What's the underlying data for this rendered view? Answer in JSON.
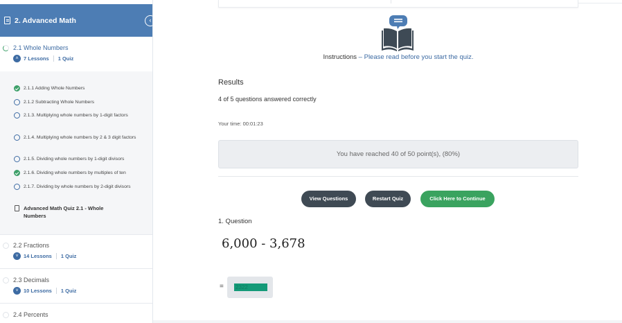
{
  "sidebar": {
    "course_title": "2. Advanced Math",
    "collapse_glyph": "‹",
    "active_section": {
      "title": "2.1 Whole Numbers",
      "lessons": "7 Lessons",
      "quizzes": "1 Quiz",
      "chevron": "˄"
    },
    "lessons": [
      {
        "label": "2.1.1 Adding Whole Numbers",
        "state": "complete"
      },
      {
        "label": "2.1.2 Subtracting Whole Numbers",
        "state": "incomplete"
      },
      {
        "label": "2.1.3. Multiplying whole numbers by 1-digit factors",
        "state": "incomplete"
      },
      {
        "label": "2.1.4. Multiplying whole numbers by 2 & 3 digit factors",
        "state": "incomplete"
      },
      {
        "label": "2.1.5. Dividing whole numbers by 1-digit divisors",
        "state": "incomplete"
      },
      {
        "label": "2.1.6. Dividing whole numbers by multiples of ten",
        "state": "complete"
      },
      {
        "label": "2.1.7. Dividing by whole numbers by 2-digit divisors",
        "state": "incomplete"
      },
      {
        "label": "Advanced Math Quiz 2.1 - Whole Numbers",
        "state": "quiz"
      }
    ],
    "sections": [
      {
        "title": "2.2 Fractions",
        "lessons": "14 Lessons",
        "quizzes": "1 Quiz",
        "chevron": "˅"
      },
      {
        "title": "2.3 Decimals",
        "lessons": "10 Lessons",
        "quizzes": "1 Quiz",
        "chevron": "˅"
      },
      {
        "title": "2.4 Percents"
      }
    ]
  },
  "main": {
    "instructions_strong": "Instructions",
    "instructions_soft": " – Please read before you start the quiz.",
    "results_title": "Results",
    "results_summary": "4 of 5 questions answered correctly",
    "time_label": "Your time: 00:01:23",
    "points_message": "You have reached 40 of 50 point(s), (80%)",
    "buttons": {
      "view": "View Questions",
      "restart": "Restart Quiz",
      "continue": "Click Here to Continue"
    },
    "question_heading": "1. Question",
    "question_expression": "6,000 - 3,678",
    "equals_sign": "=",
    "answer_value": "2322"
  },
  "colors": {
    "brand_blue": "#4d7db4",
    "link_blue": "#3d6ba3",
    "complete_green": "#3ea06a",
    "continue_green": "#3aa35f",
    "dark_button": "#3f4a54",
    "answer_fill": "#149a78"
  }
}
